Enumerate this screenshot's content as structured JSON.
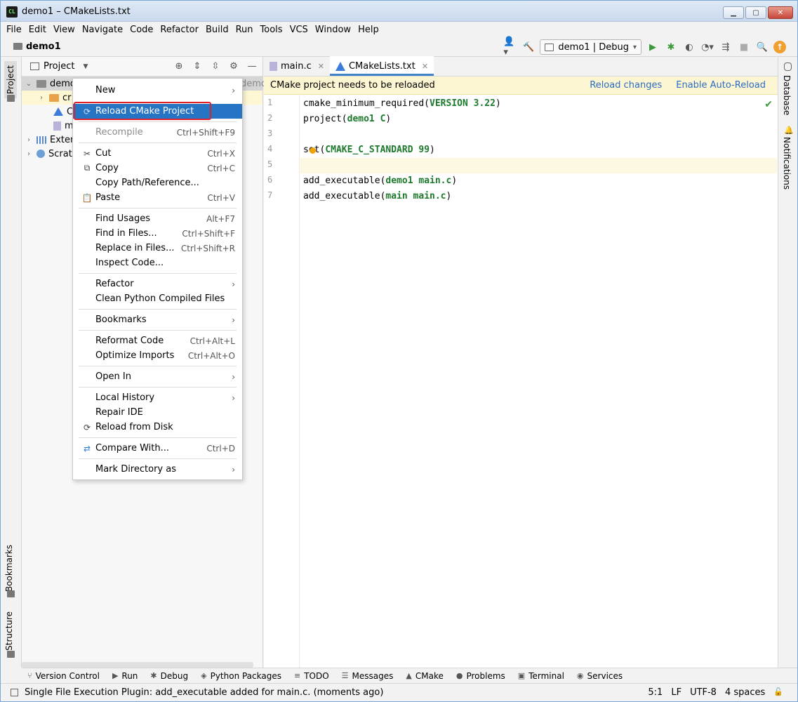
{
  "window": {
    "title": "demo1 – CMakeLists.txt",
    "app_icon": "CL",
    "controls": {
      "minimize": "▁",
      "maximize": "▢",
      "close": "✕"
    }
  },
  "menu": [
    "File",
    "Edit",
    "View",
    "Navigate",
    "Code",
    "Refactor",
    "Build",
    "Run",
    "Tools",
    "VCS",
    "Window",
    "Help"
  ],
  "navbar": {
    "project": "demo1",
    "run_config": "demo1 | Debug"
  },
  "left_strip": {
    "project_tab": "Project",
    "bookmarks_tab": "Bookmarks",
    "structure_tab": "Structure"
  },
  "right_strip": {
    "database_tab": "Database",
    "notifications_tab": "Notifications"
  },
  "project_panel": {
    "title": "Project",
    "tree": [
      {
        "label": "demo",
        "suffix": "demo"
      },
      {
        "label": "cr"
      },
      {
        "label": "CI"
      },
      {
        "label": "m"
      },
      {
        "label": "Exterr"
      },
      {
        "label": "Scratc"
      }
    ]
  },
  "context_menu": {
    "items": [
      {
        "label": "New",
        "submenu": "›"
      },
      {
        "label": "Reload CMake Project",
        "icon": "⟳"
      },
      {
        "label": "Recompile",
        "shortcut": "Ctrl+Shift+F9"
      },
      {
        "label": "Cut",
        "shortcut": "Ctrl+X",
        "icon": "✂"
      },
      {
        "label": "Copy",
        "shortcut": "Ctrl+C",
        "icon": "⧉"
      },
      {
        "label": "Copy Path/Reference..."
      },
      {
        "label": "Paste",
        "shortcut": "Ctrl+V",
        "icon": "📋"
      },
      {
        "label": "Find Usages",
        "shortcut": "Alt+F7"
      },
      {
        "label": "Find in Files...",
        "shortcut": "Ctrl+Shift+F"
      },
      {
        "label": "Replace in Files...",
        "shortcut": "Ctrl+Shift+R"
      },
      {
        "label": "Inspect Code..."
      },
      {
        "label": "Refactor",
        "submenu": "›"
      },
      {
        "label": "Clean Python Compiled Files"
      },
      {
        "label": "Bookmarks",
        "submenu": "›"
      },
      {
        "label": "Reformat Code",
        "shortcut": "Ctrl+Alt+L"
      },
      {
        "label": "Optimize Imports",
        "shortcut": "Ctrl+Alt+O"
      },
      {
        "label": "Open In",
        "submenu": "›"
      },
      {
        "label": "Local History",
        "submenu": "›"
      },
      {
        "label": "Repair IDE"
      },
      {
        "label": "Reload from Disk",
        "icon": "⟳"
      },
      {
        "label": "Compare With...",
        "shortcut": "Ctrl+D",
        "icon": "⇄"
      },
      {
        "label": "Mark Directory as",
        "submenu": "›"
      }
    ]
  },
  "editor": {
    "tabs": [
      {
        "label": "main.c",
        "close": "✕"
      },
      {
        "label": "CMakeLists.txt",
        "close": "✕"
      }
    ],
    "banner": {
      "message": "CMake project needs to be reloaded",
      "reload_link": "Reload changes",
      "auto_reload_link": "Enable Auto-Reload"
    },
    "line_numbers": [
      "1",
      "2",
      "3",
      "4",
      "5",
      "6",
      "7"
    ],
    "lines": [
      {
        "pre": "cmake_minimum_required(",
        "kw": "VERSION 3.22",
        "post": ")"
      },
      {
        "pre": "project(",
        "kw": "demo1 C",
        "post": ")"
      },
      {
        "pre": "",
        "kw": "",
        "post": ""
      },
      {
        "pre": "set(",
        "kw": "CMAKE_C_STANDARD 99",
        "post": ")"
      },
      {
        "pre": "",
        "kw": "",
        "post": ""
      },
      {
        "pre": "add_executable(",
        "kw": "demo1 main.c",
        "post": ")"
      },
      {
        "pre": "add_executable(",
        "kw": "main main.c",
        "post": ")"
      }
    ],
    "check": "✔"
  },
  "bottom_tools": [
    {
      "label": "Version Control",
      "icon": "⑂"
    },
    {
      "label": "Run",
      "icon": "▶"
    },
    {
      "label": "Debug",
      "icon": "✱"
    },
    {
      "label": "Python Packages",
      "icon": "◈"
    },
    {
      "label": "TODO",
      "icon": "≡"
    },
    {
      "label": "Messages",
      "icon": "☰"
    },
    {
      "label": "CMake",
      "icon": "▲"
    },
    {
      "label": "Problems",
      "icon": "●"
    },
    {
      "label": "Terminal",
      "icon": "▣"
    },
    {
      "label": "Services",
      "icon": "◉"
    }
  ],
  "status": {
    "message": "Single File Execution Plugin: add_executable added for main.c. (moments ago)",
    "position": "5:1",
    "line_sep": "LF",
    "encoding": "UTF-8",
    "indent": "4 spaces",
    "lock": "🔓"
  }
}
